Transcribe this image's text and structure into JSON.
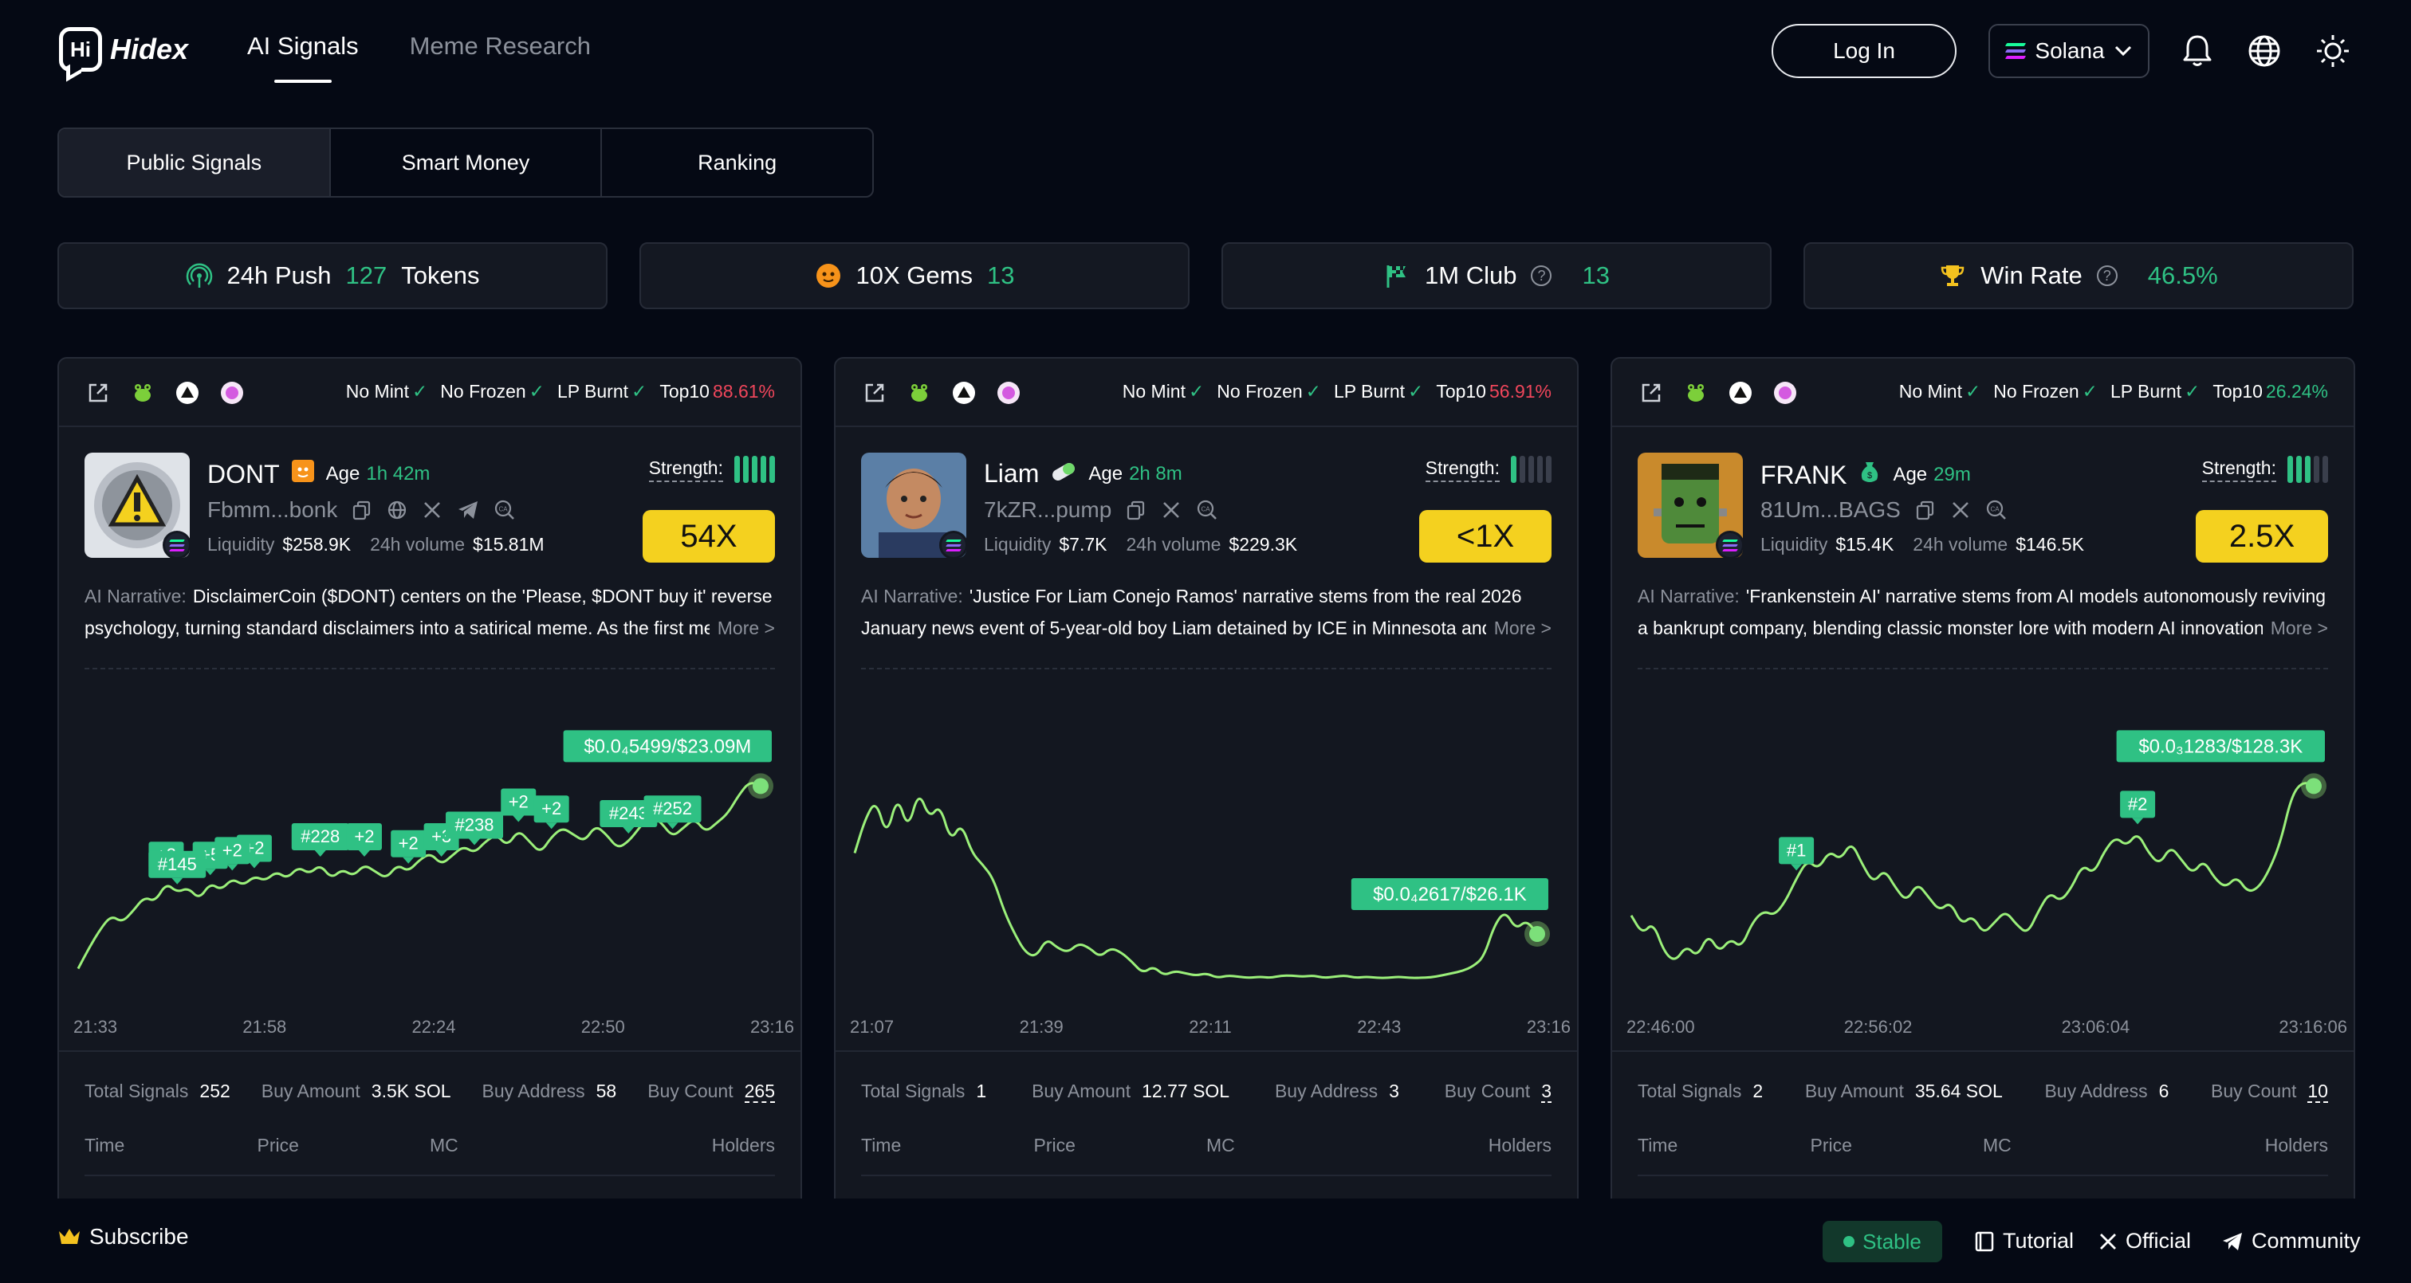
{
  "header": {
    "logo_text": "Hidex",
    "logo_mark": "Hi",
    "nav": [
      {
        "label": "AI Signals",
        "active": true
      },
      {
        "label": "Meme Research",
        "active": false
      }
    ],
    "login_label": "Log In",
    "chain_label": "Solana",
    "icons": [
      "bell-icon",
      "globe-icon",
      "sun-icon"
    ]
  },
  "tabs": [
    {
      "label": "Public Signals",
      "active": true
    },
    {
      "label": "Smart Money",
      "active": false
    },
    {
      "label": "Ranking",
      "active": false
    }
  ],
  "stats": [
    {
      "label": "24h Push",
      "value": "127",
      "suffix": "Tokens",
      "icon": "signal-icon"
    },
    {
      "label": "10X Gems",
      "value": "13",
      "icon": "gem-icon"
    },
    {
      "label": "1M Club",
      "value": "13",
      "icon": "flag-icon",
      "help": "?"
    },
    {
      "label": "Win Rate",
      "value": "46.5%",
      "icon": "trophy-icon",
      "help": "?"
    }
  ],
  "check_labels": {
    "no_mint": "No Mint",
    "no_frozen": "No Frozen",
    "lp_burnt": "LP Burnt",
    "top10": "Top10",
    "check": "✓"
  },
  "labels": {
    "age": "Age",
    "strength": "Strength:",
    "liquidity": "Liquidity",
    "volume": "24h volume",
    "narrative": "AI Narrative:",
    "more": "More >",
    "total_signals": "Total Signals",
    "buy_amount": "Buy Amount",
    "buy_address": "Buy Address",
    "buy_count": "Buy Count",
    "col_time": "Time",
    "col_price": "Price",
    "col_mc": "MC",
    "col_holders": "Holders"
  },
  "cards": [
    {
      "name": "DONT",
      "age": "1h 42m",
      "address": "Fbmm...bonk",
      "liquidity": "$258.9K",
      "volume": "$15.81M",
      "top10": "88.61%",
      "top10_color": "#f0465b",
      "strength": 5,
      "multiplier": "54X",
      "narrative": "DisclaimerCoin ($DONT) centers on the 'Please, $DONT buy it' reverse psychology, turning standard disclaimers into a satirical meme. As the first meme",
      "price_tag": "$0.0₄5499/$23.09M",
      "x_ticks": [
        "21:33",
        "21:58",
        "22:24",
        "22:50",
        "23:16"
      ],
      "total_signals": "252",
      "buy_amount": "3.5K SOL",
      "buy_address": "58",
      "buy_count": "265",
      "line": [
        0.05,
        0.14,
        0.22,
        0.28,
        0.25,
        0.3,
        0.36,
        0.34,
        0.42,
        0.38,
        0.4,
        0.35,
        0.42,
        0.39,
        0.44,
        0.41,
        0.45,
        0.43,
        0.47,
        0.44,
        0.49,
        0.46,
        0.5,
        0.44,
        0.48,
        0.45,
        0.5,
        0.47,
        0.44,
        0.5,
        0.47,
        0.52,
        0.55,
        0.5,
        0.54,
        0.58,
        0.55,
        0.6,
        0.63,
        0.58,
        0.65,
        0.6,
        0.55,
        0.62,
        0.66,
        0.63,
        0.6,
        0.67,
        0.63,
        0.57,
        0.6,
        0.66,
        0.72,
        0.68,
        0.62,
        0.66,
        0.7,
        0.64,
        0.68,
        0.72,
        0.8,
        0.86,
        0.84
      ],
      "markers": [
        {
          "label": "+3",
          "i": 8
        },
        {
          "label": "+5",
          "i": 12
        },
        {
          "label": "+2",
          "i": 16
        },
        {
          "label": "#228",
          "i": 22
        },
        {
          "label": "#145",
          "i": 9
        },
        {
          "label": "+2",
          "i": 14
        },
        {
          "label": "+2",
          "i": 26
        },
        {
          "label": "+2",
          "i": 30
        },
        {
          "label": "+3",
          "i": 33
        },
        {
          "label": "#238",
          "i": 36
        },
        {
          "label": "+2",
          "i": 40
        },
        {
          "label": "+2",
          "i": 43
        },
        {
          "label": "#243",
          "i": 50
        },
        {
          "label": "#252",
          "i": 54
        }
      ]
    },
    {
      "name": "Liam",
      "age": "2h 8m",
      "address": "7kZR...pump",
      "liquidity": "$7.7K",
      "volume": "$229.3K",
      "top10": "56.91%",
      "top10_color": "#f0465b",
      "strength": 1,
      "multiplier": "<1X",
      "narrative": "'Justice For Liam Conejo Ramos' narrative stems from the real 2026 January news event of 5-year-old boy Liam detained by ICE in Minnesota and used",
      "price_tag": "$0.0₄2617/$26.1K",
      "x_ticks": [
        "21:07",
        "21:39",
        "22:11",
        "22:43",
        "23:16"
      ],
      "total_signals": "1",
      "buy_amount": "12.77 SOL",
      "buy_address": "3",
      "buy_count": "3",
      "line": [
        0.55,
        0.7,
        0.78,
        0.62,
        0.8,
        0.65,
        0.82,
        0.7,
        0.76,
        0.6,
        0.68,
        0.55,
        0.5,
        0.44,
        0.3,
        0.2,
        0.12,
        0.1,
        0.18,
        0.14,
        0.12,
        0.16,
        0.14,
        0.1,
        0.14,
        0.12,
        0.08,
        0.03,
        0.06,
        0.02,
        0.04,
        0.03,
        0.02,
        0.03,
        0.01,
        0.02,
        0.015,
        0.01,
        0.015,
        0.01,
        0.02,
        0.02,
        0.015,
        0.02,
        0.01,
        0.015,
        0.02,
        0.01,
        0.015,
        0.01,
        0.01,
        0.015,
        0.01,
        0.01,
        0.012,
        0.02,
        0.03,
        0.04,
        0.06,
        0.1,
        0.24,
        0.3,
        0.22,
        0.26,
        0.2
      ],
      "markers": []
    },
    {
      "name": "FRANK",
      "age": "29m",
      "address": "81Um...BAGS",
      "liquidity": "$15.4K",
      "volume": "$146.5K",
      "top10": "26.24%",
      "top10_color": "#2fc184",
      "strength": 3,
      "multiplier": "2.5X",
      "narrative": "'Frankenstein AI' narrative stems from AI models autonomously reviving a bankrupt company, blending classic monster lore with modern AI innovation. W",
      "price_tag": "$0.0₃1283/$128.3K",
      "x_ticks": [
        "22:46:00",
        "22:56:02",
        "23:06:04",
        "23:16:06"
      ],
      "total_signals": "2",
      "buy_amount": "35.64 SOL",
      "buy_address": "6",
      "buy_count": "10",
      "line": [
        0.28,
        0.2,
        0.25,
        0.12,
        0.08,
        0.15,
        0.1,
        0.2,
        0.12,
        0.18,
        0.14,
        0.25,
        0.3,
        0.28,
        0.34,
        0.44,
        0.52,
        0.48,
        0.56,
        0.52,
        0.6,
        0.5,
        0.42,
        0.48,
        0.4,
        0.34,
        0.42,
        0.36,
        0.3,
        0.34,
        0.24,
        0.28,
        0.2,
        0.25,
        0.3,
        0.24,
        0.2,
        0.3,
        0.38,
        0.34,
        0.4,
        0.5,
        0.46,
        0.56,
        0.62,
        0.58,
        0.64,
        0.55,
        0.5,
        0.58,
        0.52,
        0.46,
        0.52,
        0.44,
        0.4,
        0.45,
        0.38,
        0.4,
        0.48,
        0.6,
        0.8,
        0.86,
        0.84
      ],
      "markers": [
        {
          "label": "#1",
          "i": 15
        },
        {
          "label": "#2",
          "i": 46
        }
      ]
    }
  ],
  "footer": {
    "subscribe": "Subscribe",
    "stable": "Stable",
    "links": [
      {
        "label": "Tutorial",
        "icon": "book-icon"
      },
      {
        "label": "Official",
        "icon": "x-icon"
      },
      {
        "label": "Community",
        "icon": "telegram-icon"
      }
    ]
  },
  "colors": {
    "accent": "#2fc184",
    "negative": "#f0465b",
    "multiplier": "#f4d11f",
    "line": "#9bf07a",
    "background": "#050914",
    "card": "#131720"
  }
}
